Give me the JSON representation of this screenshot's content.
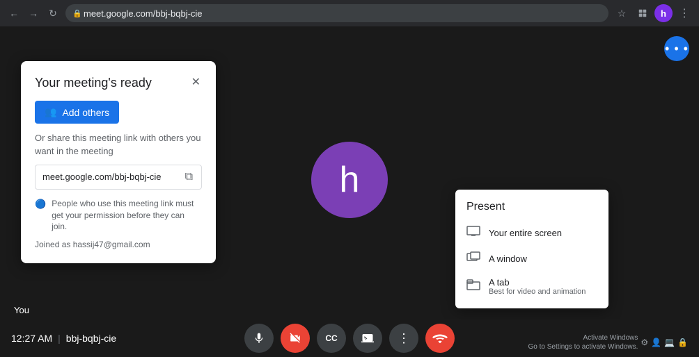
{
  "browser": {
    "back_label": "←",
    "forward_label": "→",
    "reload_label": "↻",
    "url": "meet.google.com/bbj-bqbj-cie",
    "bookmark_icon": "☆",
    "extension_icon": "🧩",
    "menu_icon": "⋮",
    "profile_initial": "h"
  },
  "meeting_card": {
    "title": "Your meeting's ready",
    "close_label": "✕",
    "add_others_label": "Add others",
    "share_text": "Or share this meeting link with others you want in the meeting",
    "meeting_link": "meet.google.com/bbj-bqbj-cie",
    "copy_icon": "⧉",
    "security_text": "People who use this meeting link must get your permission before they can join.",
    "joined_as": "Joined as hassij47@gmail.com"
  },
  "user": {
    "avatar_letter": "h",
    "you_label": "You"
  },
  "present_popup": {
    "title": "Present",
    "items": [
      {
        "label": "Your entire screen",
        "sublabel": "",
        "icon": "🖥"
      },
      {
        "label": "A window",
        "sublabel": "",
        "icon": "⬜"
      },
      {
        "label": "A tab",
        "sublabel": "Best for video and animation",
        "icon": "⬛"
      }
    ]
  },
  "bottom_bar": {
    "time": "12:27 AM",
    "divider": "|",
    "meeting_code": "bbj-bqbj-cie"
  },
  "controls": [
    {
      "name": "microphone",
      "icon": "🎤",
      "active": true
    },
    {
      "name": "camera-off",
      "icon": "📷",
      "active": false
    },
    {
      "name": "captions",
      "icon": "CC",
      "active": false
    },
    {
      "name": "present",
      "icon": "⬆",
      "active": false
    },
    {
      "name": "more",
      "icon": "⋮",
      "active": false
    },
    {
      "name": "end-call",
      "icon": "📞",
      "active": false
    }
  ],
  "top_right_dots_icon": "⋯",
  "activate_windows": {
    "line1": "Activate Windows",
    "line2": "Go to Settings to activate Windows."
  }
}
